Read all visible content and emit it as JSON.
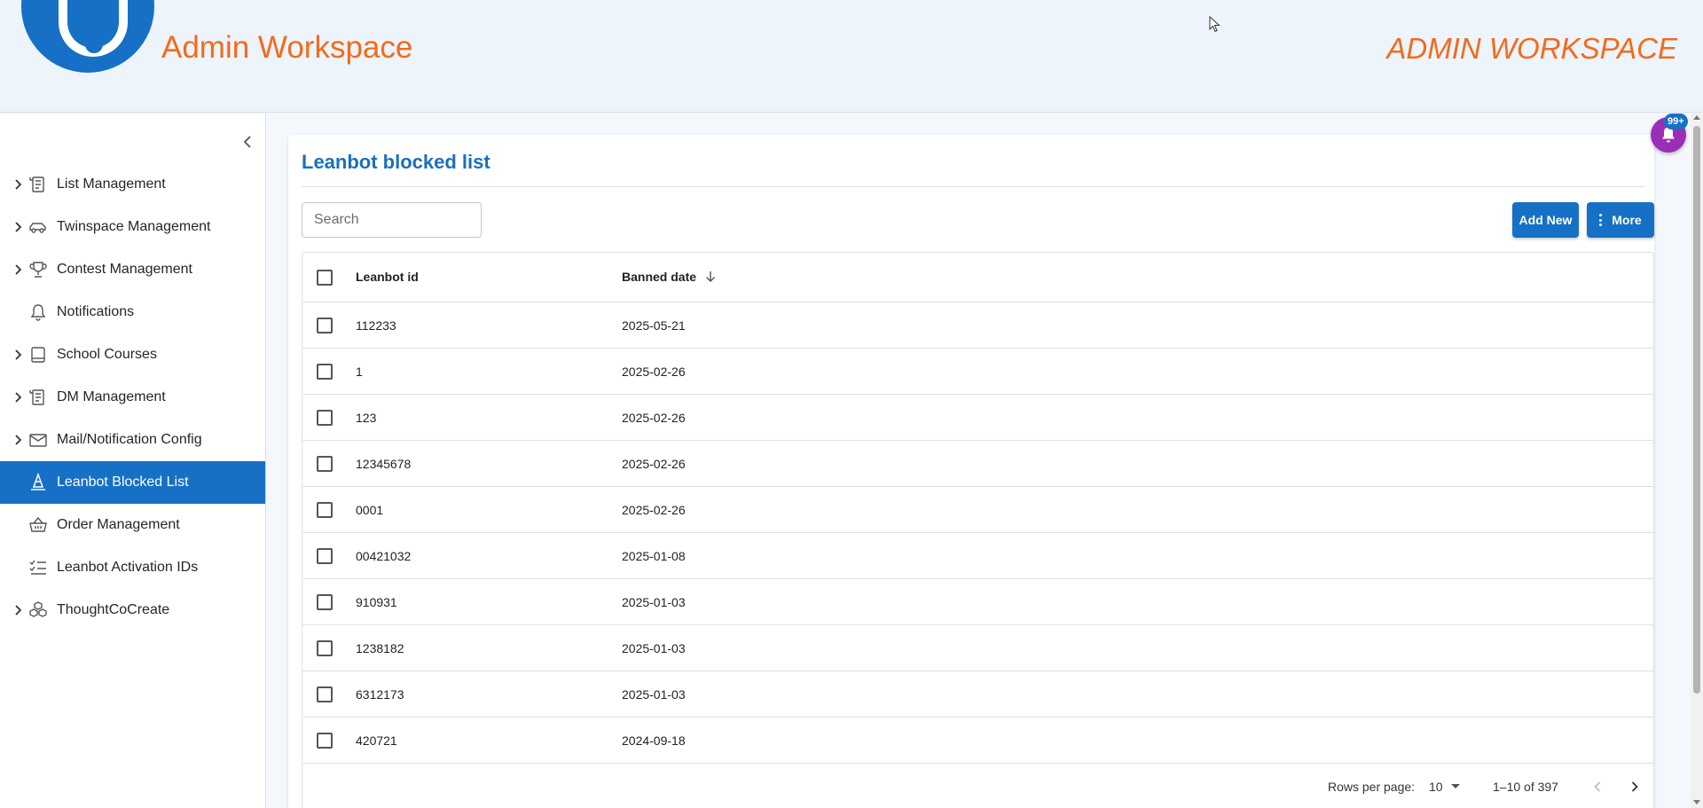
{
  "header": {
    "app_title": "Admin Workspace",
    "app_title_right": "ADMIN WORKSPACE"
  },
  "colors": {
    "primary": "#1670c6",
    "accent_orange": "#f26b1d",
    "notification": "#9b2eb6"
  },
  "sidebar": {
    "items": [
      {
        "label": "List Management",
        "icon": "list-icon",
        "expandable": true
      },
      {
        "label": "Twinspace Management",
        "icon": "car-icon",
        "expandable": true
      },
      {
        "label": "Contest Management",
        "icon": "trophy-icon",
        "expandable": true
      },
      {
        "label": "Notifications",
        "icon": "bell-icon",
        "expandable": false
      },
      {
        "label": "School Courses",
        "icon": "book-icon",
        "expandable": true
      },
      {
        "label": "DM Management",
        "icon": "list-icon",
        "expandable": true
      },
      {
        "label": "Mail/Notification Config",
        "icon": "mail-icon",
        "expandable": true
      },
      {
        "label": "Leanbot Blocked List",
        "icon": "cone-icon",
        "expandable": false,
        "active": true
      },
      {
        "label": "Order Management",
        "icon": "basket-icon",
        "expandable": false
      },
      {
        "label": "Leanbot Activation IDs",
        "icon": "checklist-icon",
        "expandable": false
      },
      {
        "label": "ThoughtCoCreate",
        "icon": "cubes-icon",
        "expandable": true
      }
    ]
  },
  "main": {
    "title": "Leanbot blocked list",
    "search_placeholder": "Search",
    "add_new_label": "Add New",
    "more_label": "More",
    "columns": [
      "Leanbot id",
      "Banned date"
    ],
    "rows": [
      {
        "id": "112233",
        "date": "2025-05-21"
      },
      {
        "id": "1",
        "date": "2025-02-26"
      },
      {
        "id": "123",
        "date": "2025-02-26"
      },
      {
        "id": "12345678",
        "date": "2025-02-26"
      },
      {
        "id": "0001",
        "date": "2025-02-26"
      },
      {
        "id": "00421032",
        "date": "2025-01-08"
      },
      {
        "id": "910931",
        "date": "2025-01-03"
      },
      {
        "id": "1238182",
        "date": "2025-01-03"
      },
      {
        "id": "6312173",
        "date": "2025-01-03"
      },
      {
        "id": "420721",
        "date": "2024-09-18"
      }
    ],
    "pagination": {
      "rows_per_page_label": "Rows per page:",
      "rows_per_page": "10",
      "range": "1–10 of 397"
    }
  },
  "notification_badge": "99+"
}
